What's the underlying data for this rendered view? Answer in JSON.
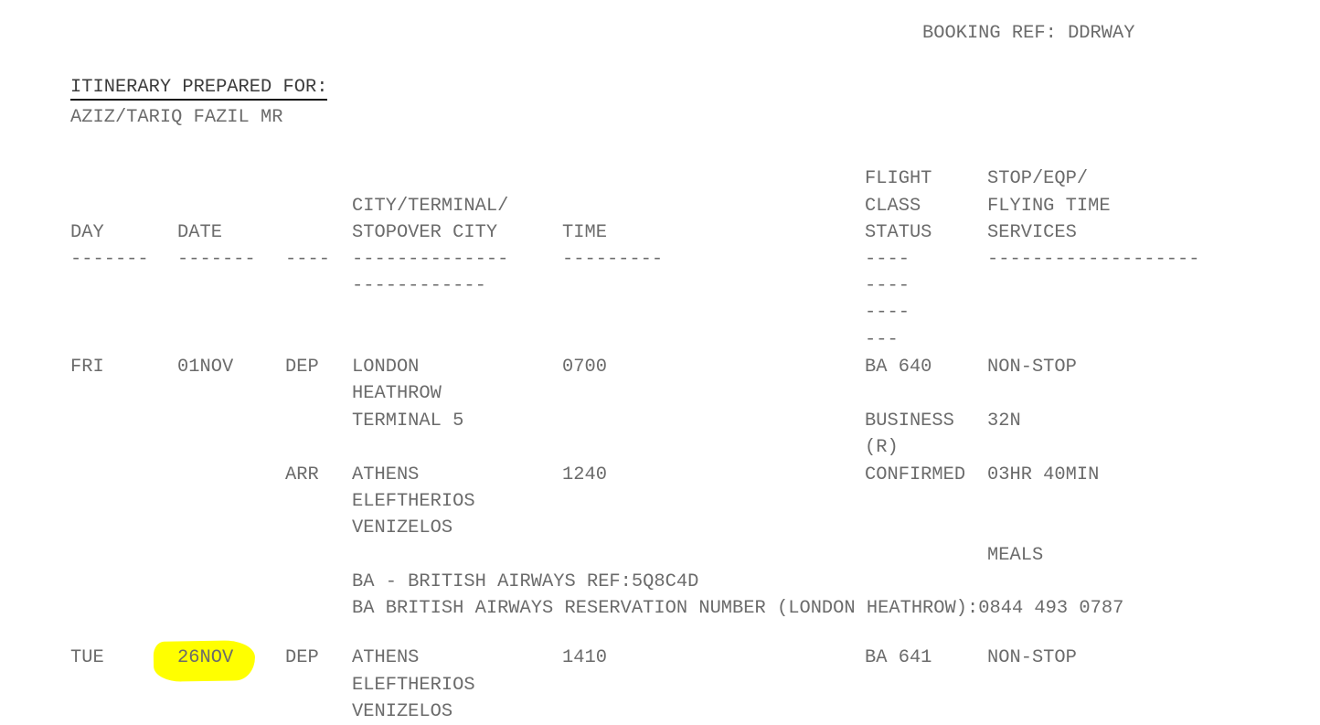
{
  "booking_ref": "BOOKING REF: DDRWAY",
  "prepared_for": {
    "label": "ITINERARY PREPARED FOR:",
    "name": "AZIZ/TARIQ FAZIL MR"
  },
  "headers": {
    "flight_1": "FLIGHT",
    "flight_2": "CLASS",
    "flight_3": "STATUS",
    "stop_1": "STOP/EQP/",
    "stop_2": "FLYING TIME",
    "stop_3": "SERVICES",
    "city_1": "CITY/TERMINAL/",
    "city_2": "STOPOVER CITY",
    "day": "DAY",
    "date": "DATE",
    "time": "TIME"
  },
  "dashes": {
    "day": "-------",
    "date": "-------",
    "dep": "----",
    "city_1": "--------------",
    "city_2": "------------",
    "time": "---------",
    "flight_1": "----",
    "flight_2": "----",
    "flight_3": "----",
    "flight_4": "---",
    "services": "-------------------"
  },
  "seg1": {
    "day": "FRI",
    "date": "01NOV",
    "dep": "DEP",
    "dep_city_1": "LONDON",
    "dep_city_2": "HEATHROW",
    "dep_city_3": "TERMINAL 5",
    "dep_time": "0700",
    "flight": "BA 640",
    "stops": "NON-STOP",
    "class_1": "BUSINESS",
    "class_2": "(R)",
    "eqp": "32N",
    "arr": "ARR",
    "arr_city_1": "ATHENS",
    "arr_city_2": "ELEFTHERIOS",
    "arr_city_3": "VENIZELOS",
    "arr_time": "1240",
    "status": "CONFIRMED",
    "flying_time": "03HR 40MIN",
    "meals": "MEALS",
    "ref": "BA - BRITISH AIRWAYS REF:5Q8C4D",
    "reservation": "BA BRITISH AIRWAYS RESERVATION NUMBER (LONDON HEATHROW):0844 493 0787"
  },
  "seg2": {
    "day": "TUE",
    "date": "26NOV",
    "dep": "DEP",
    "dep_city_1": "ATHENS",
    "dep_city_2": "ELEFTHERIOS",
    "dep_city_3": "VENIZELOS",
    "dep_time": "1410",
    "flight": "BA 641",
    "stops": "NON-STOP"
  },
  "colors": {
    "highlight": "#ffff00",
    "text": "#6b6b6b"
  }
}
